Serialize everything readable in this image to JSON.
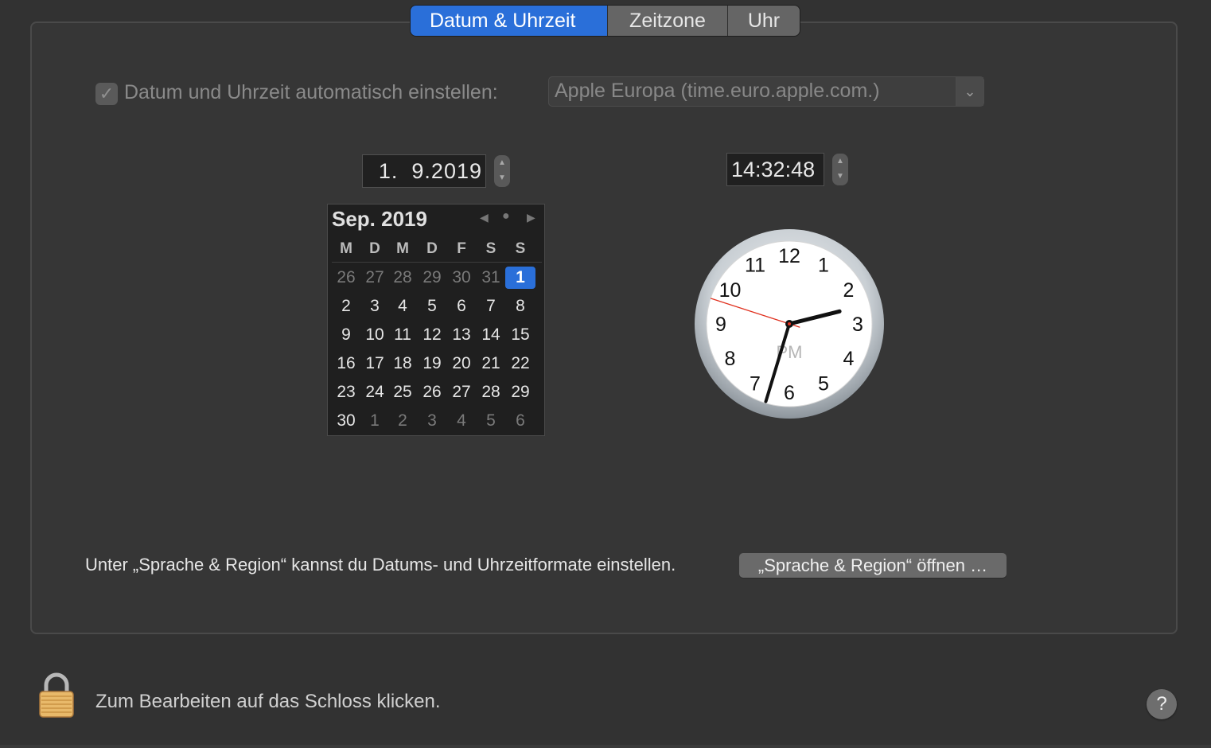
{
  "tabs": [
    {
      "label": "Datum & Uhrzeit",
      "active": true
    },
    {
      "label": "Zeitzone",
      "active": false
    },
    {
      "label": "Uhr",
      "active": false
    }
  ],
  "auto_set": {
    "checked": true,
    "label": "Datum und Uhrzeit automatisch einstellen:",
    "server": "Apple Europa (time.euro.apple.com.)"
  },
  "date_field": {
    "value": "1.  9.2019"
  },
  "time_field": {
    "value": "14:32:48"
  },
  "calendar": {
    "title": "Sep. 2019",
    "weekdays": [
      "M",
      "D",
      "M",
      "D",
      "F",
      "S",
      "S"
    ],
    "weeks": [
      [
        "26",
        "27",
        "28",
        "29",
        "30",
        "31",
        "1"
      ],
      [
        "2",
        "3",
        "4",
        "5",
        "6",
        "7",
        "8"
      ],
      [
        "9",
        "10",
        "11",
        "12",
        "13",
        "14",
        "15"
      ],
      [
        "16",
        "17",
        "18",
        "19",
        "20",
        "21",
        "22"
      ],
      [
        "23",
        "24",
        "25",
        "26",
        "27",
        "28",
        "29"
      ],
      [
        "30",
        "1",
        "2",
        "3",
        "4",
        "5",
        "6"
      ]
    ],
    "selected_day": "1"
  },
  "clock": {
    "numbers": [
      "12",
      "1",
      "2",
      "3",
      "4",
      "5",
      "6",
      "7",
      "8",
      "9",
      "10",
      "11"
    ],
    "meridiem": "PM",
    "time": {
      "hours": 14,
      "minutes": 32,
      "seconds": 48
    }
  },
  "format_note": "Unter „Sprache & Region“ kannst du Datums- und Uhrzeitformate einstellen.",
  "open_region_button": "„Sprache & Region“ öffnen …",
  "lock_label": "Zum Bearbeiten auf das Schloss klicken.",
  "help_label": "?",
  "colors": {
    "accent": "#2a6fd9",
    "background": "#323232",
    "second_hand": "#e0301e"
  }
}
